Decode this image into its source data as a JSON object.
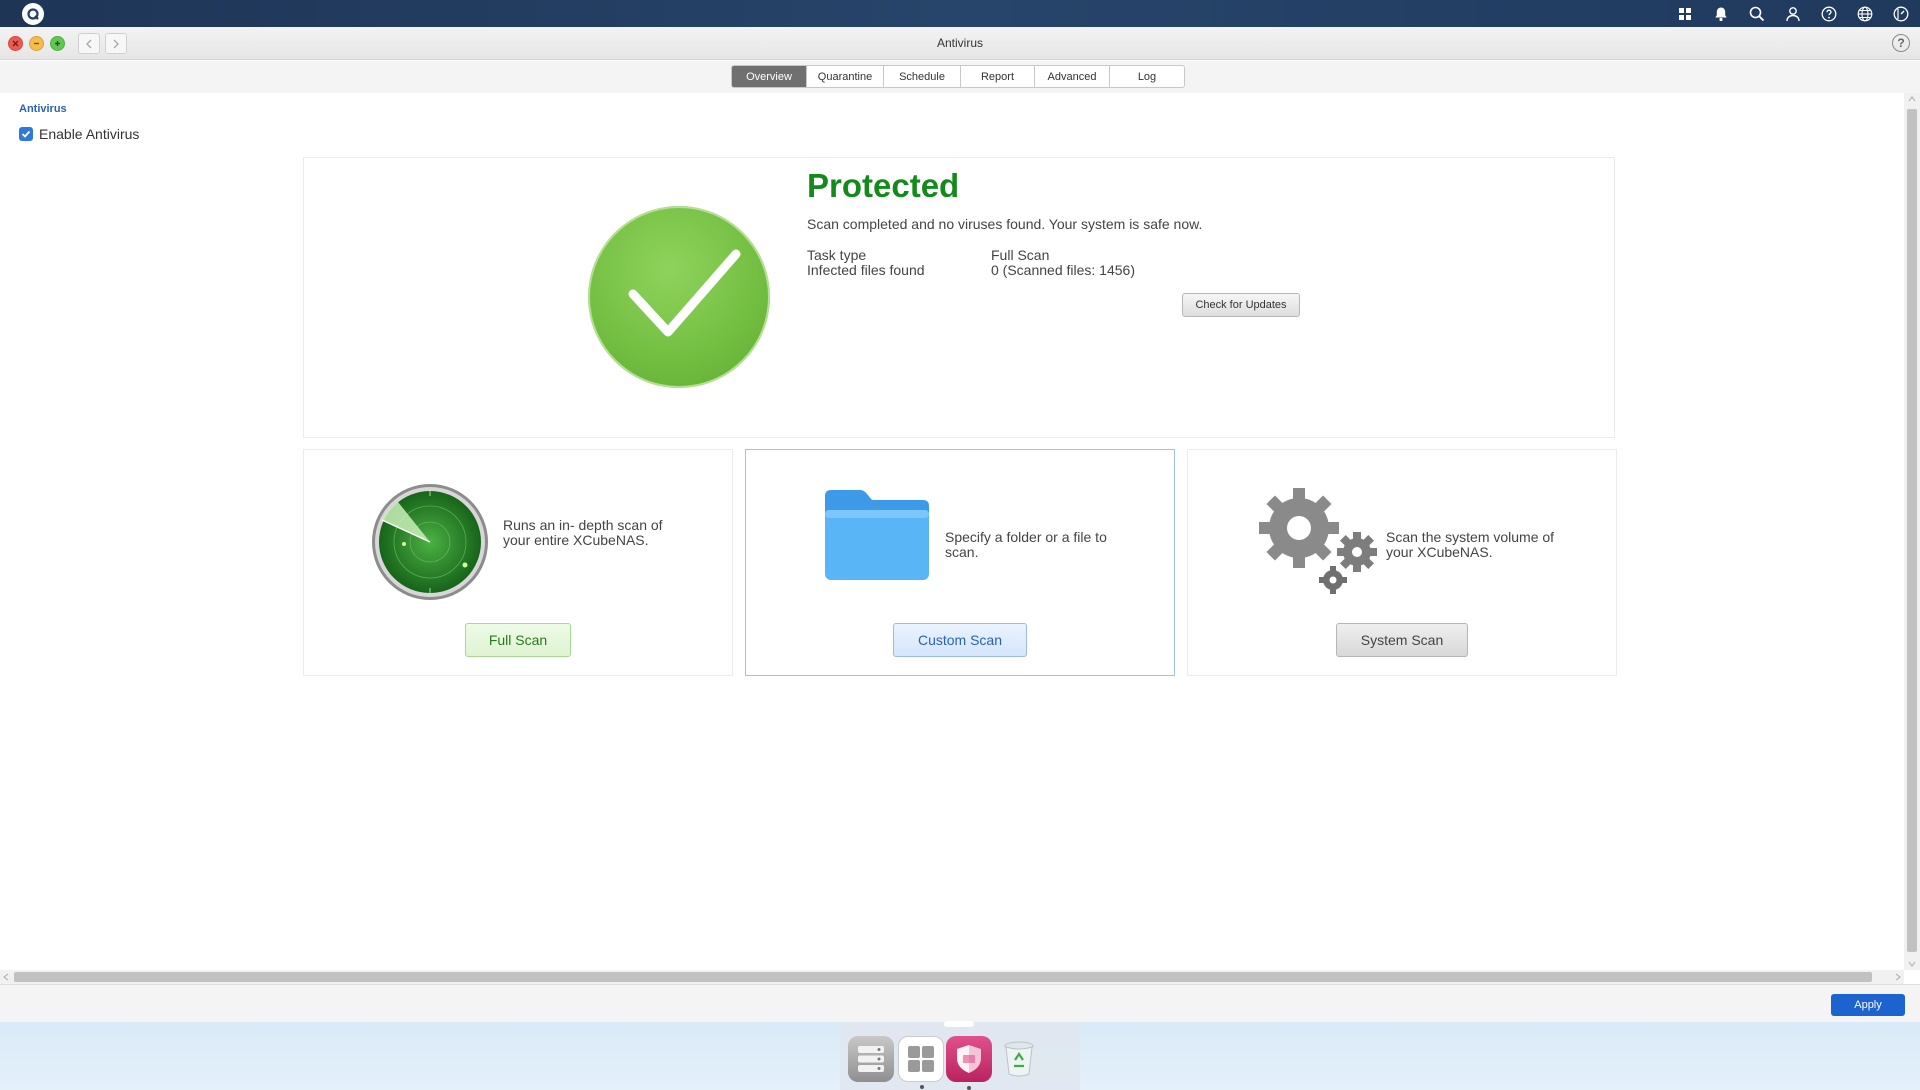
{
  "window": {
    "title": "Antivirus"
  },
  "tabs": [
    {
      "label": "Overview",
      "active": true
    },
    {
      "label": "Quarantine",
      "active": false
    },
    {
      "label": "Schedule",
      "active": false
    },
    {
      "label": "Report",
      "active": false
    },
    {
      "label": "Advanced",
      "active": false
    },
    {
      "label": "Log",
      "active": false
    }
  ],
  "section": {
    "title": "Antivirus",
    "enable_label": "Enable Antivirus",
    "enabled": true
  },
  "status": {
    "title": "Protected",
    "message": "Scan completed and no viruses found. Your system is safe now.",
    "task_type_label": "Task type",
    "task_type_value": "Full Scan",
    "infected_label": "Infected files found",
    "infected_value": "0 (Scanned files: 1456)",
    "check_updates_label": "Check for Updates"
  },
  "scans": {
    "full": {
      "description": "Runs an in- depth scan of your entire XCubeNAS.",
      "button": "Full Scan"
    },
    "custom": {
      "description": "Specify a folder or a file to scan.",
      "button": "Custom Scan"
    },
    "system": {
      "description": "Scan the system volume of your XCubeNAS.",
      "button": "System Scan"
    }
  },
  "footer": {
    "apply_label": "Apply"
  },
  "colors": {
    "protected_green": "#158a1c",
    "accent_blue": "#1d63cf",
    "titlebar_navy": "#1e3556"
  },
  "icons": {
    "topbar": [
      "apps-icon",
      "bell-icon",
      "search-icon",
      "user-icon",
      "help-icon",
      "globe-icon",
      "dashboard-icon"
    ],
    "dock": [
      "storage-manager-icon",
      "app-center-icon",
      "antivirus-shield-icon",
      "recycle-bin-icon"
    ]
  }
}
